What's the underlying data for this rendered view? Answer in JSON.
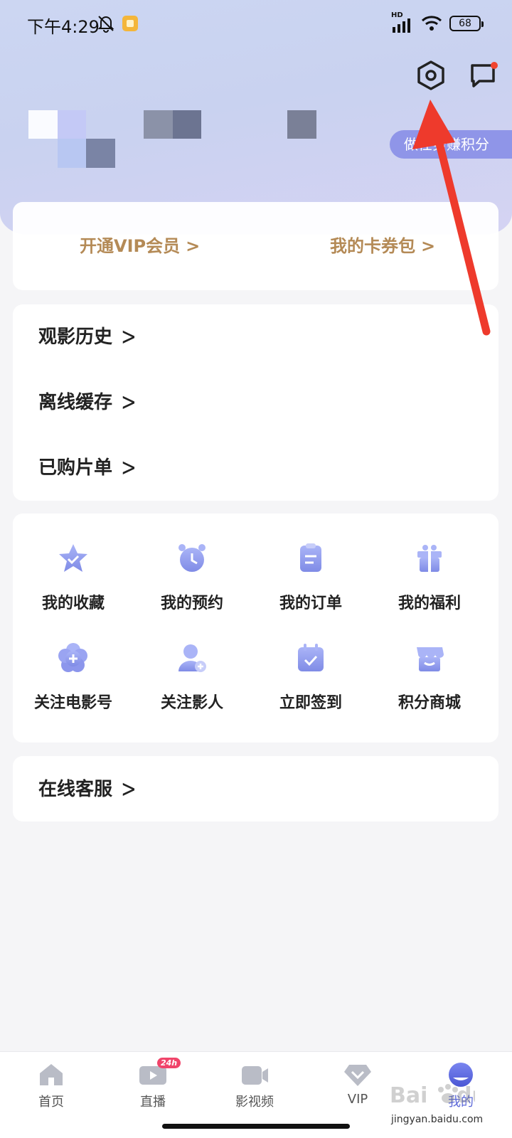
{
  "status_bar": {
    "time": "下午4:29",
    "hd": "HD",
    "battery": "68"
  },
  "header": {
    "earn_points": "做任务赚积分",
    "settings_icon": "hexagon-gear-icon",
    "message_icon": "chat-bubble-icon",
    "message_badge_color": "#f0442e"
  },
  "vip_card": {
    "open_vip": "开通VIP会员",
    "coupon_wallet": "我的卡券包",
    "chevron": ">",
    "accent": "#b48a56"
  },
  "list": {
    "items": [
      {
        "label": "观影历史"
      },
      {
        "label": "离线缓存"
      },
      {
        "label": "已购片单"
      }
    ],
    "chevron": ">"
  },
  "grid": {
    "items": [
      {
        "label": "我的收藏",
        "icon": "star-icon"
      },
      {
        "label": "我的预约",
        "icon": "alarm-clock-icon"
      },
      {
        "label": "我的订单",
        "icon": "clipboard-icon"
      },
      {
        "label": "我的福利",
        "icon": "gift-icon"
      },
      {
        "label": "关注电影号",
        "icon": "flower-plus-icon"
      },
      {
        "label": "关注影人",
        "icon": "person-add-icon"
      },
      {
        "label": "立即签到",
        "icon": "calendar-check-icon"
      },
      {
        "label": "积分商城",
        "icon": "store-icon"
      }
    ],
    "icon_color": "#8c95ec"
  },
  "service": {
    "label": "在线客服",
    "chevron": ">"
  },
  "tab_bar": {
    "tabs": [
      {
        "label": "首页",
        "icon": "home-icon"
      },
      {
        "label": "直播",
        "icon": "tv-icon",
        "badge": "24h"
      },
      {
        "label": "影视频",
        "icon": "video-camera-icon"
      },
      {
        "label": "VIP",
        "icon": "diamond-icon"
      },
      {
        "label": "我的",
        "icon": "profile-icon",
        "active": true
      }
    ],
    "active_color": "#5b67d8"
  },
  "watermark": {
    "logo": "Baidu 经验",
    "url": "jingyan.baidu.com"
  }
}
